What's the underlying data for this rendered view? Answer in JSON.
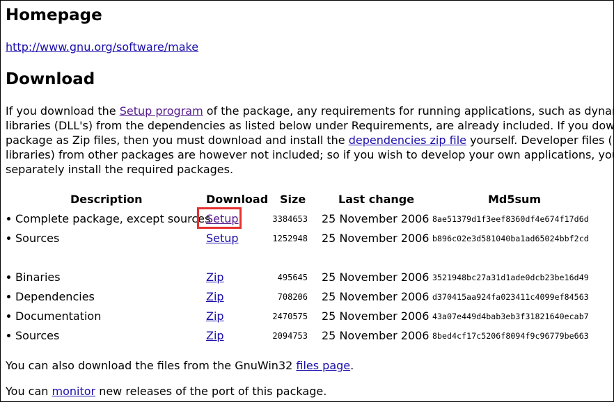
{
  "homepage": {
    "heading": "Homepage",
    "url": "http://www.gnu.org/software/make"
  },
  "download": {
    "heading": "Download",
    "para_lines": [
      [
        "If you download the ",
        "Setup program",
        " of the package, any requirements for running applications, such as dynamic link"
      ],
      [
        "libraries (DLL's) from the dependencies as listed below under Requirements, are already included. If you download the"
      ],
      [
        "package as Zip files, then you must download and install the ",
        "dependencies zip file",
        " yourself. Developer files (header files"
      ],
      [
        "libraries) from other packages are however not included; so if you wish to develop your own applications, you must"
      ],
      [
        "separately install the required packages."
      ]
    ]
  },
  "table": {
    "headers": {
      "description": "Description",
      "download": "Download",
      "size": "Size",
      "last_change": "Last change",
      "md5": "Md5sum"
    },
    "rows": [
      {
        "description": "Complete package, except sources",
        "link": "Setup",
        "size": "3384653",
        "date": "25 November 2006",
        "md5": "8ae51379d1f3eef8360df4e674f17d6d"
      },
      {
        "description": "Sources",
        "link": "Setup",
        "size": "1252948",
        "date": "25 November 2006",
        "md5": "b896c02e3d581040ba1ad65024bbf2cd"
      },
      {
        "description": "Binaries",
        "link": "Zip",
        "size": "495645",
        "date": "25 November 2006",
        "md5": "3521948bc27a31d1ade0dcb23be16d49"
      },
      {
        "description": "Dependencies",
        "link": "Zip",
        "size": "708206",
        "date": "25 November 2006",
        "md5": "d370415aa924fa023411c4099ef84563"
      },
      {
        "description": "Documentation",
        "link": "Zip",
        "size": "2470575",
        "date": "25 November 2006",
        "md5": "43a07e449d4bab3eb3f31821640ecab7"
      },
      {
        "description": "Sources",
        "link": "Zip",
        "size": "2094753",
        "date": "25 November 2006",
        "md5": "8bed4cf17c5206f8094f9c96779be663"
      }
    ]
  },
  "footer": {
    "line1_prefix": "You can also download the files from the GnuWin32 ",
    "line1_link": "files page",
    "line1_suffix": ".",
    "line2_prefix": "You can ",
    "line2_link": "monitor",
    "line2_suffix": " new releases of the port of this package."
  },
  "colors": {
    "link": "#1a0dab",
    "visited_link": "#551a8b",
    "highlight": "#e53030"
  }
}
